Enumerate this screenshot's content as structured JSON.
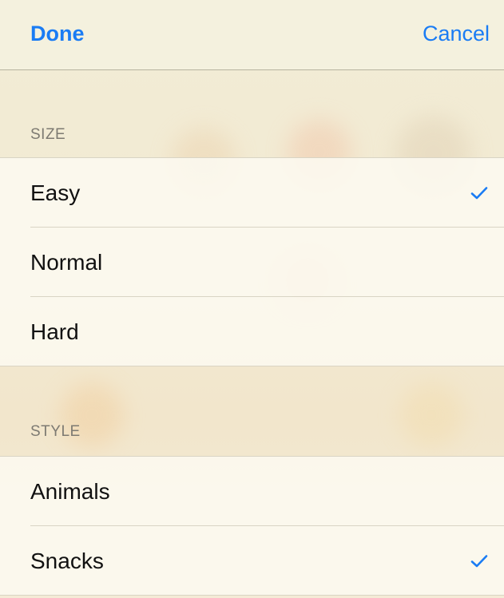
{
  "navbar": {
    "done_label": "Done",
    "cancel_label": "Cancel"
  },
  "size_section": {
    "header": "SIZE",
    "options": [
      {
        "label": "Easy",
        "selected": true
      },
      {
        "label": "Normal",
        "selected": false
      },
      {
        "label": "Hard",
        "selected": false
      }
    ]
  },
  "style_section": {
    "header": "STYLE",
    "options": [
      {
        "label": "Animals",
        "selected": false
      },
      {
        "label": "Snacks",
        "selected": true
      }
    ]
  },
  "colors": {
    "accent": "#1a7cf4",
    "text": "#111111",
    "header_text": "#7d7a72"
  },
  "icons": {
    "selected": "checkmark-icon"
  }
}
